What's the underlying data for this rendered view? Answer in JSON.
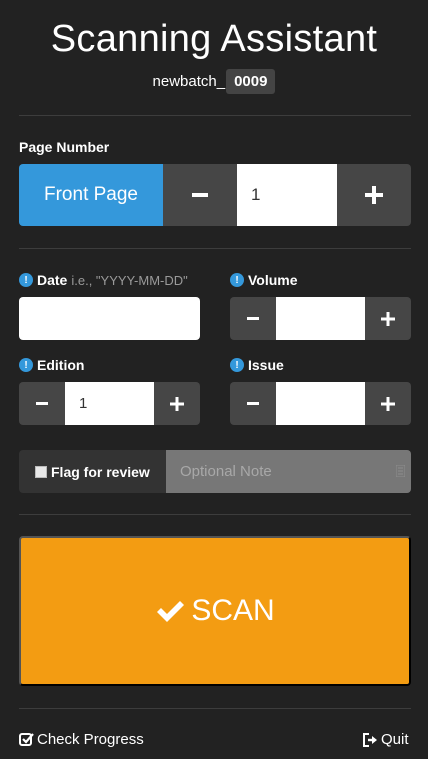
{
  "header": {
    "title": "Scanning Assistant",
    "batch_prefix": "newbatch_",
    "batch_number": "0009"
  },
  "page_number": {
    "label": "Page Number",
    "front_page_label": "Front Page",
    "value": "1"
  },
  "date": {
    "label": "Date",
    "hint": "i.e., \"YYYY-MM-DD\"",
    "value": ""
  },
  "volume": {
    "label": "Volume",
    "value": ""
  },
  "edition": {
    "label": "Edition",
    "value": "1"
  },
  "issue": {
    "label": "Issue",
    "value": ""
  },
  "flag": {
    "label": "Flag for review",
    "checked": false,
    "note_placeholder": "Optional Note"
  },
  "scan": {
    "label": "SCAN",
    "color": "#f39c12"
  },
  "footer": {
    "check_progress_label": "Check Progress",
    "quit_label": "Quit"
  },
  "colors": {
    "background": "#222222",
    "accent_blue": "#3498db",
    "button_dark": "#464646"
  },
  "icons": [
    "info-icon",
    "minus-icon",
    "plus-icon",
    "checkmark-icon",
    "check-square-icon",
    "sign-out-icon"
  ]
}
